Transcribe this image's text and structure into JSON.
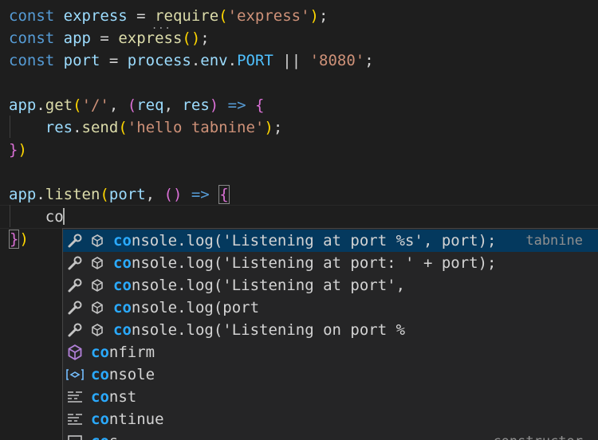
{
  "code": {
    "line1": {
      "kw": "const",
      "name": "express",
      "eq": " = ",
      "fn": "require",
      "p_open": "(",
      "str": "'express'",
      "p_close": ")",
      "end": ";"
    },
    "line2": {
      "kw": "const",
      "name": "app",
      "eq": " = ",
      "fn": "express",
      "parens": "()",
      "end": ";"
    },
    "line3": {
      "kw": "const",
      "name": "port",
      "eq": " = ",
      "obj": "process",
      "dot1": ".",
      "prop": "env",
      "dot2": ".",
      "const": "PORT",
      "or": " || ",
      "str": "'8080'",
      "end": ";"
    },
    "line5": {
      "obj": "app",
      "dot": ".",
      "fn": "get",
      "p_open": "(",
      "str": "'/'",
      "comma": ", ",
      "p2_open": "(",
      "arg1": "req",
      "comma2": ", ",
      "arg2": "res",
      "p2_close": ")",
      "arrow": " => ",
      "brace": "{"
    },
    "line6": {
      "obj": "res",
      "dot": ".",
      "fn": "send",
      "p_open": "(",
      "str": "'hello tabnine'",
      "p_close": ")",
      "end": ";"
    },
    "line7": {
      "brace": "}",
      "p_close": ")"
    },
    "line9": {
      "obj": "app",
      "dot": ".",
      "fn": "listen",
      "p_open": "(",
      "arg": "port",
      "comma": ", ",
      "p2": "()",
      "arrow": " => ",
      "brace": "{"
    },
    "line10": {
      "typed": "co"
    },
    "line11": {
      "brace": "}",
      "p_close": ")"
    },
    "hover_dots": "..."
  },
  "suggestions": [
    {
      "icon": "wrench-icon",
      "icon2": "cube-outline-icon",
      "match": "co",
      "rest": "nsole.log('Listening at port %s', port);",
      "detail": "tabnine",
      "selected": true
    },
    {
      "icon": "wrench-icon",
      "icon2": "cube-outline-icon",
      "match": "co",
      "rest": "nsole.log('Listening at port: ' + port);"
    },
    {
      "icon": "wrench-icon",
      "icon2": "cube-outline-icon",
      "match": "co",
      "rest": "nsole.log('Listening at port',"
    },
    {
      "icon": "wrench-icon",
      "icon2": "cube-outline-icon",
      "match": "co",
      "rest": "nsole.log(port"
    },
    {
      "icon": "wrench-icon",
      "icon2": "cube-outline-icon",
      "match": "co",
      "rest": "nsole.log('Listening on port %"
    },
    {
      "icon": "method-cube-icon",
      "match": "co",
      "rest": "nfirm"
    },
    {
      "icon": "variable-icon",
      "match": "co",
      "rest": "nsole"
    },
    {
      "icon": "keyword-icon",
      "match": "co",
      "rest": "nst"
    },
    {
      "icon": "keyword-icon",
      "match": "co",
      "rest": "ntinue"
    },
    {
      "icon": "snippet-icon",
      "match": "co",
      "rest": "s",
      "detail": "constructor"
    }
  ],
  "colors": {
    "background": "#1e1e1e",
    "selection": "#04395e",
    "match": "#2aaaff",
    "keyword": "#569cd6",
    "string": "#ce9178"
  }
}
